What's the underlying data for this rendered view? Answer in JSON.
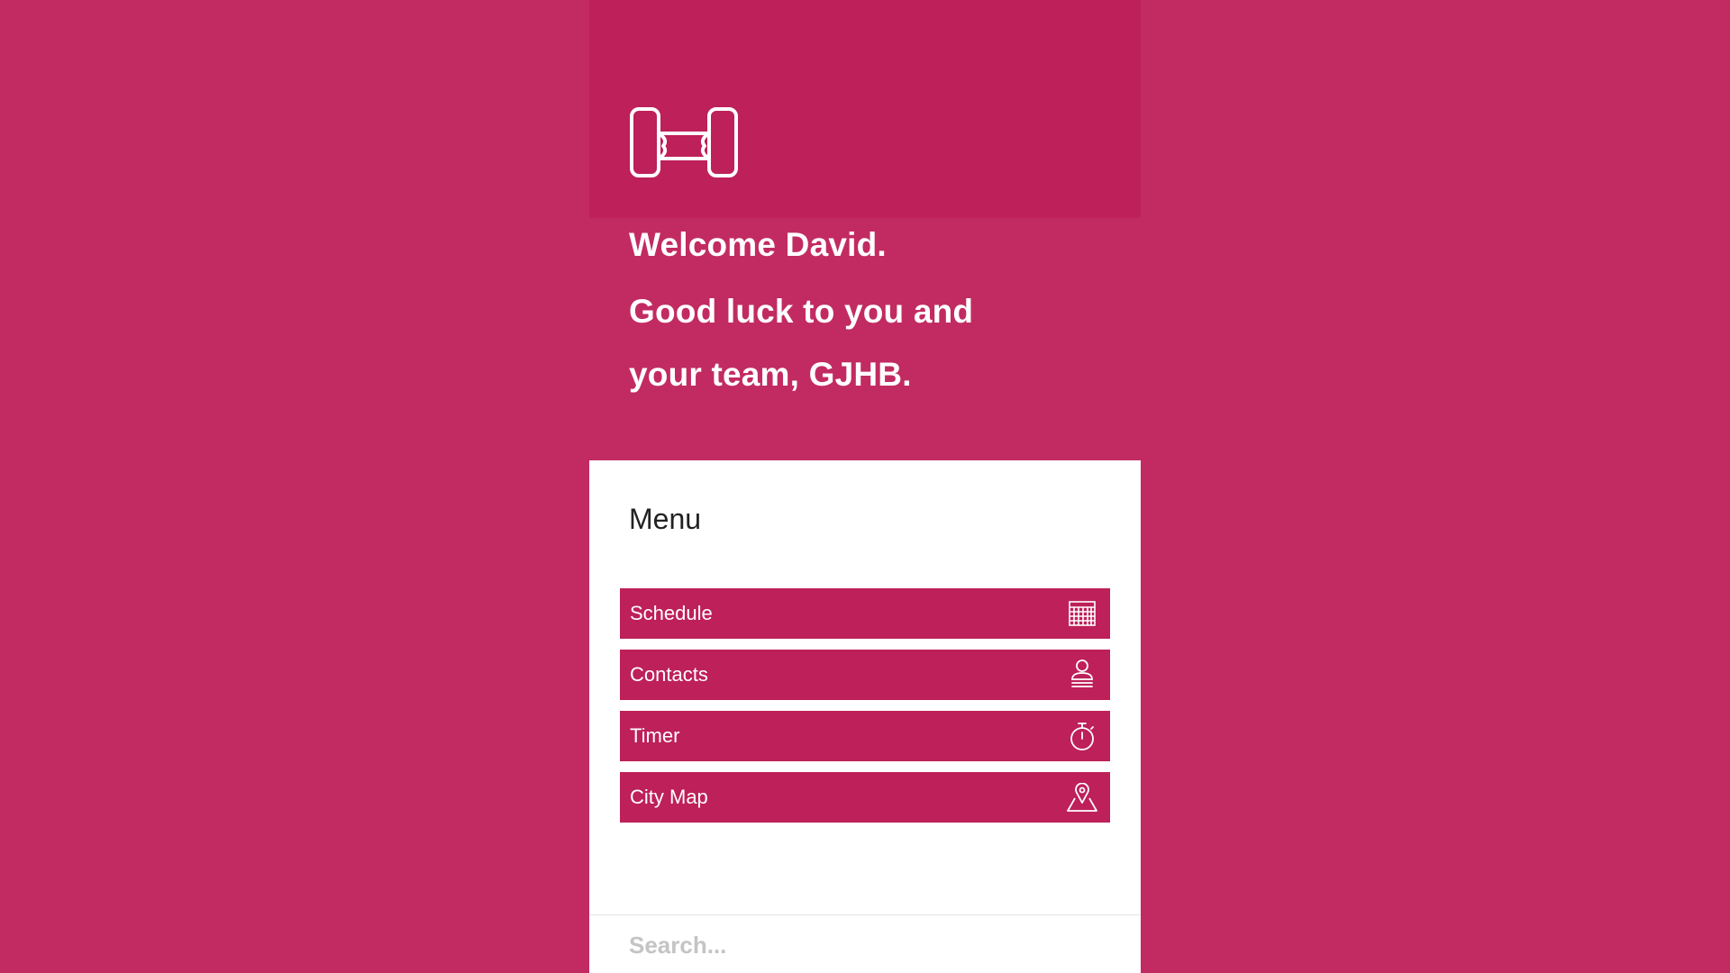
{
  "header": {
    "logo_icon": "ticket-icon",
    "welcome": "Welcome David.",
    "greeting_line1": "Good luck to you and",
    "greeting_line2": "your team, GJHB."
  },
  "menu": {
    "title": "Menu",
    "items": [
      {
        "label": "Schedule",
        "icon": "calendar-icon"
      },
      {
        "label": "Contacts",
        "icon": "person-icon"
      },
      {
        "label": "Timer",
        "icon": "stopwatch-icon"
      },
      {
        "label": "City Map",
        "icon": "map-pin-icon"
      }
    ]
  },
  "search": {
    "placeholder": "Search..."
  },
  "colors": {
    "background": "#c22b61",
    "header_dark": "#be2059",
    "menu_item": "#be2059",
    "text_on_accent": "#ffffff"
  }
}
